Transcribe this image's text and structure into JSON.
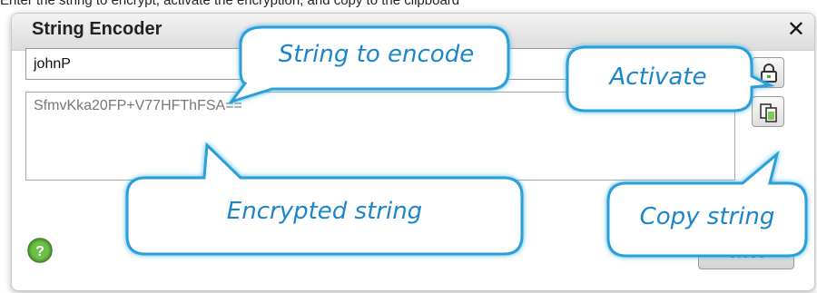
{
  "instruction": "Enter the string to encrypt, activate the encryption, and copy to the clipboard",
  "dialog": {
    "title": "String Encoder",
    "close_glyph": "✕",
    "input_value": "johnP",
    "output_value": "SfmvKka20FP+V77HFThFSA==",
    "close_label": "Close",
    "help_glyph": "?"
  },
  "callouts": {
    "string_to_encode": "String to encode",
    "activate": "Activate",
    "encrypted_string": "Encrypted string",
    "copy_string": "Copy string"
  },
  "icons": {
    "lock": "lock-icon",
    "copy": "copy-icon",
    "help": "help-icon"
  },
  "colors": {
    "callout_text": "#1a86c9",
    "callout_glow": "#5ec6f0",
    "help_green": "#5aa63a"
  }
}
